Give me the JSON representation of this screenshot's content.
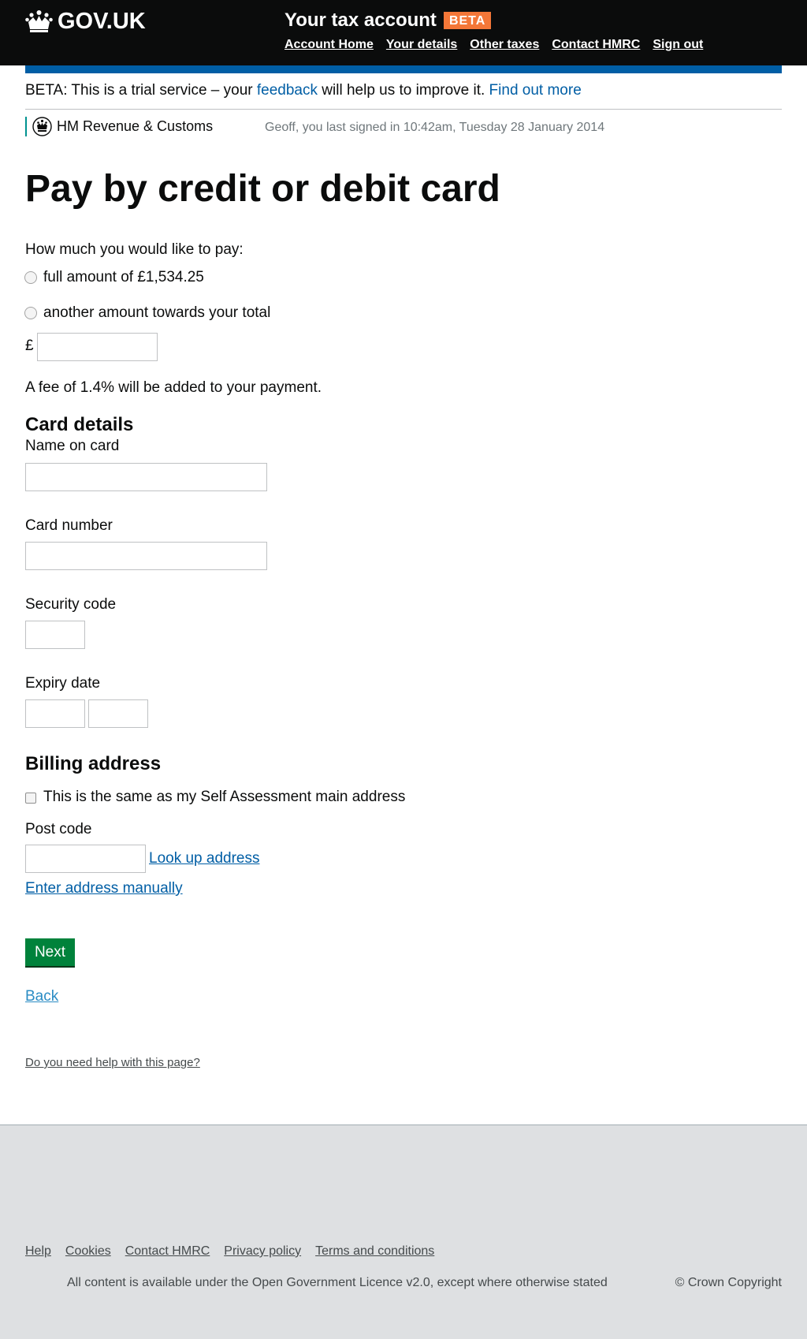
{
  "header": {
    "logo_text": "GOV.UK",
    "service_name": "Your tax account",
    "beta_tag": "BETA",
    "nav": [
      "Account Home",
      "Your details",
      "Other taxes",
      "Contact HMRC",
      "Sign out"
    ]
  },
  "beta_banner": {
    "prefix": "BETA: This is a trial service – your",
    "feedback_link": "feedback",
    "middle": "will help us to improve it.",
    "find_out_more": "Find out more"
  },
  "org": {
    "name": "HM Revenue & Customs",
    "last_signed_in": "Geoff, you last signed in 10:42am, Tuesday 28 January 2014"
  },
  "page": {
    "title": "Pay by credit or debit card",
    "amount_question": "How much you would like to pay:",
    "option_full": "full amount of £1,534.25",
    "option_other": "another amount towards your total",
    "currency_symbol": "£",
    "fee_notice": "A fee of 1.4% will be added to your payment."
  },
  "card": {
    "heading": "Card details",
    "name_label": "Name on card",
    "number_label": "Card number",
    "security_label": "Security code",
    "expiry_label": "Expiry date"
  },
  "billing": {
    "heading": "Billing address",
    "same_address_label": "This is the same as my Self Assessment main address",
    "postcode_label": "Post code",
    "lookup_link": "Look up address",
    "manual_link": "Enter address manually"
  },
  "actions": {
    "next": "Next",
    "back": "Back",
    "help": "Do you need help with this page?"
  },
  "footer": {
    "links": [
      "Help",
      "Cookies",
      "Contact HMRC",
      "Privacy policy",
      "Terms and conditions"
    ],
    "licence_prefix": "All content is available under the",
    "licence_link": "Open Government Licence v2.0",
    "licence_suffix": ", except where otherwise stated",
    "copyright": "© Crown Copyright"
  },
  "colors": {
    "header_bg": "#0b0c0c",
    "beta_tag": "#f47738",
    "link": "#005ea5",
    "button": "#00823b",
    "footer_bg": "#dee0e2"
  }
}
